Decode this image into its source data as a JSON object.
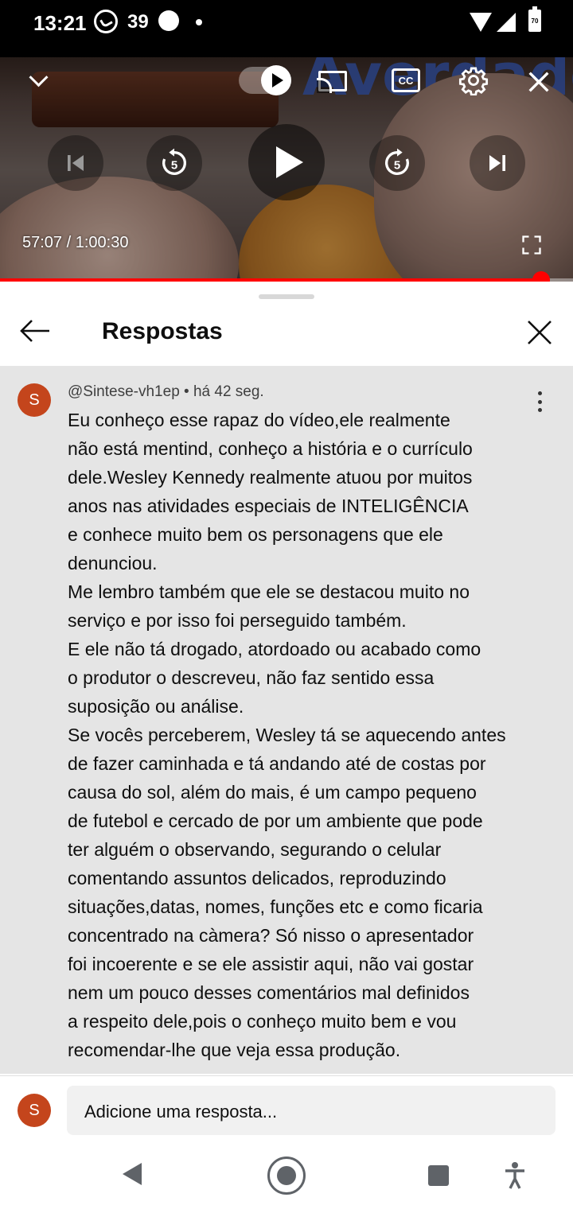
{
  "status_bar": {
    "time": "13:21",
    "notification_count": "39",
    "battery": "70"
  },
  "player": {
    "background_text": "Averdade",
    "current_time": "57:07",
    "duration": "1:00:30",
    "timecode": "57:07 / 1:00:30",
    "progress_fraction": 0.944,
    "cc_label": "CC",
    "rewind_seconds": "5",
    "forward_seconds": "5",
    "accent_color": "#ff0000"
  },
  "replies_sheet": {
    "title": "Respostas"
  },
  "comment": {
    "avatar_letter": "S",
    "author": "@Sintese-vh1ep",
    "separator": "•",
    "time_ago": "há 42 seg.",
    "meta": "@Sintese-vh1ep • há 42 seg.",
    "text": "Eu conheço esse rapaz do vídeo,ele realmente\nnão está mentind, conheço a história e o currículo\ndele.Wesley Kennedy realmente atuou por muitos\nanos nas atividades especiais de INTELIGÊNCIA\ne conhece muito bem os personagens que ele\ndenunciou.\nMe lembro também que ele se destacou muito no\nserviço e por isso foi perseguido também.\nE ele não tá drogado, atordoado ou acabado como\no produtor o descreveu, não faz sentido essa\nsuposição ou análise.\nSe vocês perceberem, Wesley tá se aquecendo antes\nde fazer caminhada e tá andando até de costas por\ncausa do sol, além do mais, é um campo pequeno\nde futebol e cercado de por um ambiente que pode\nter alguém o observando, segurando o celular\ncomentando assuntos delicados, reproduzindo\nsituações,datas, nomes, funções etc e como ficaria\nconcentrado na càmera? Só nisso o apresentador\nfoi incoerente e se ele assistir aqui, não vai gostar\nnem um pouco desses comentários mal definidos\na respeito dele,pois o conheço muito bem e vou\nrecomendar-lhe que veja essa produção."
  },
  "reply_bar": {
    "avatar_letter": "S",
    "placeholder": "Adicione uma resposta..."
  },
  "colors": {
    "avatar": "#c4451c",
    "comment_bg": "#e5e5e5"
  }
}
